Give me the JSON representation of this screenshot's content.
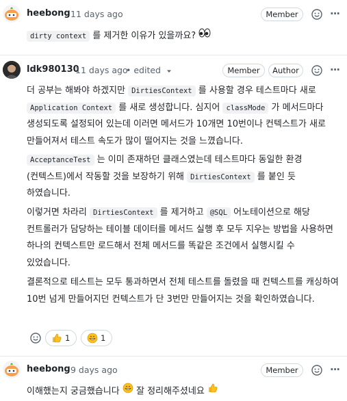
{
  "comments": [
    {
      "author": "heebong",
      "time": "11 days ago",
      "badges": [
        "Member"
      ],
      "body_intro_code": "dirty context",
      "body_intro_text": "를 제거한 이유가 있을까요?",
      "emoji": "eyes-emoji"
    },
    {
      "author": "ldk980130",
      "time": "11 days ago",
      "edited": "• edited",
      "badges": [
        "Member",
        "Author"
      ],
      "p1": {
        "a": "더 공부는 해봐야 하겠지만",
        "code1": "DirtiesContext",
        "b": "를 사용할 경우 테스트마다 새로",
        "code2": "Application Context",
        "c": "를 새로 생성합니다. 심지어",
        "code3": "classMode",
        "d": "가 메서드마다 생성되도록 설정되어 있는데 이러면 메서드가 10개면 10번이나 컨텍스트가 새로 만들어져서 테스트 속도가 많이 떨어지는 것을 느꼈습니다."
      },
      "p2": {
        "code1": "AcceptanceTest",
        "a": "는 이미 존재하던 클래스였는데 테스트마다 동일한 환경(컨텍스트)에서 작동할 것을 보장하기 위해",
        "code2": "DirtiesContext",
        "b": "를 붙인 듯 하였습니다."
      },
      "p3": {
        "a": "이렇거면 차라리",
        "code1": "DirtiesContext",
        "b": "를 제거하고",
        "code2": "@SQL",
        "c": "어노테이션으로 해당 컨트롤러가 담당하는 테이블 데이터를 메서드 실행 후 모두 지우는 방법을 사용하면 하나의 컨텍스트만 로드해서 전체 메서드를 똑같은 조건에서 실행시킬 수 있었습니다."
      },
      "p4": "결론적으로 테스트는 모두 통과하면서 전체 테스트를 돌렸을 때 컨텍스트를 캐싱하여 10번 넘게 만들어지던 컨텍스트가 단 3번만 만들어지는 것을 확인하였습니다.",
      "reactions": [
        {
          "emoji": "thumbs-up",
          "count": "1"
        },
        {
          "emoji": "grinning-face",
          "count": "1"
        }
      ]
    },
    {
      "author": "heebong",
      "time": "9 days ago",
      "badges": [
        "Member"
      ],
      "body_a": "이해했는지 궁금했습니다",
      "body_b": "잘 정리해주셨네요"
    }
  ],
  "icons": {
    "smiley": "smiley-icon",
    "more": "kebab-horizontal-icon",
    "dropdown": "triangle-down-icon"
  }
}
